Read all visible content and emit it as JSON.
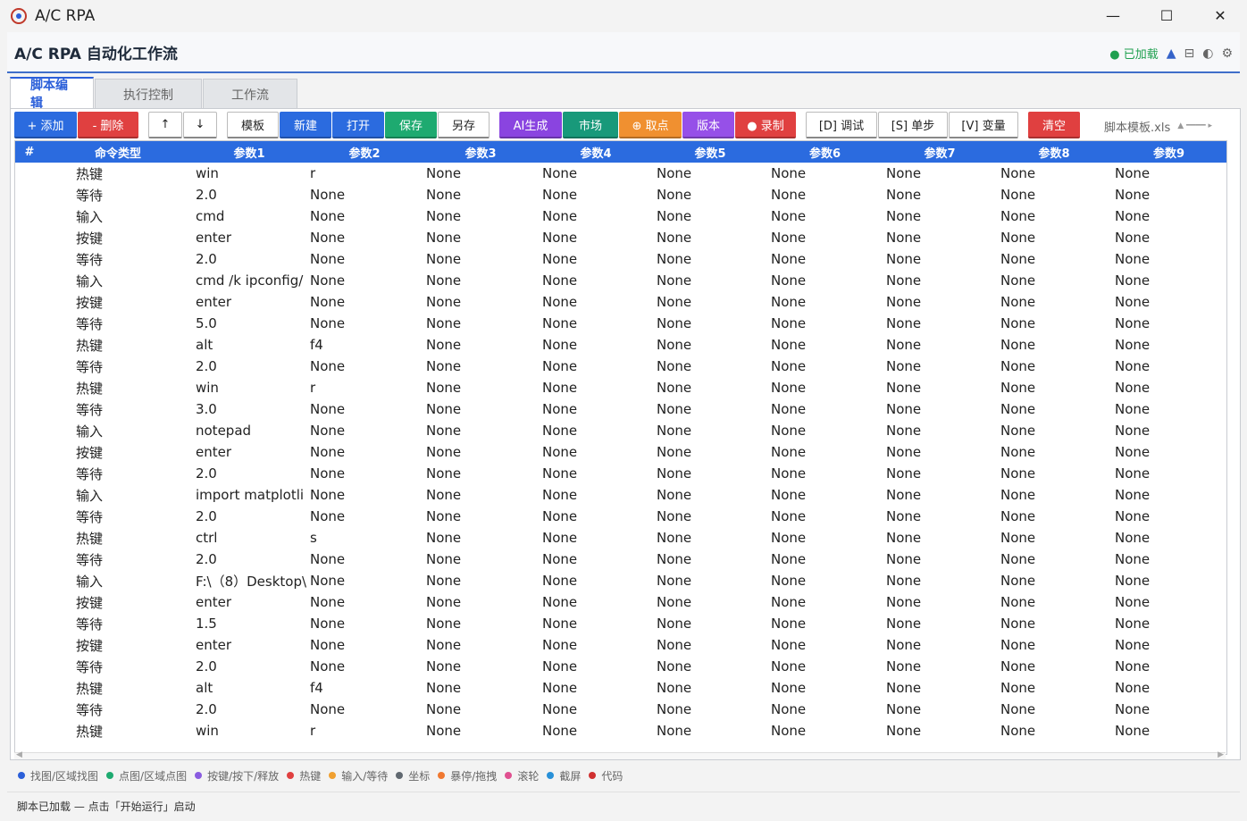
{
  "window": {
    "title": "A/C RPA",
    "controls": [
      "—",
      "☐",
      "✕"
    ]
  },
  "header": {
    "title": "A/C RPA 自动化工作流",
    "status": "● 已加载",
    "icons": [
      "▲",
      "⊟",
      "◐",
      "⚙"
    ]
  },
  "tabs": [
    {
      "label": "脚本编辑",
      "active": true
    },
    {
      "label": "执行控制",
      "active": false
    },
    {
      "label": "工作流",
      "active": false
    }
  ],
  "toolbar": {
    "buttons": [
      {
        "id": "add",
        "label": "+ 添加",
        "color": "#2b6bdf",
        "width": 70
      },
      {
        "id": "delete",
        "label": "- 删除",
        "color": "#e04040",
        "width": 68
      },
      {
        "id": "gap1",
        "gap": true
      },
      {
        "id": "up",
        "label": "↑",
        "color": "white",
        "width": 38
      },
      {
        "id": "down",
        "label": "↓",
        "color": "white",
        "width": 38
      },
      {
        "id": "gap2",
        "gap": true
      },
      {
        "id": "template",
        "label": "模板",
        "color": "white",
        "width": 58
      },
      {
        "id": "new",
        "label": "新建",
        "color": "#2b6bdf",
        "width": 58
      },
      {
        "id": "open",
        "label": "打开",
        "color": "#2b6bdf",
        "width": 58
      },
      {
        "id": "save",
        "label": "保存",
        "color": "#1eaa70",
        "width": 58
      },
      {
        "id": "saveas",
        "label": "另存",
        "color": "white",
        "width": 58
      },
      {
        "id": "gap3",
        "gap": true
      },
      {
        "id": "ai",
        "label": "AI生成",
        "color": "#8a44e0",
        "width": 70
      },
      {
        "id": "market",
        "label": "市场",
        "color": "#18997a",
        "width": 62
      },
      {
        "id": "pick",
        "label": "⊕ 取点",
        "color": "#f09030",
        "width": 70
      },
      {
        "id": "version",
        "label": "版本",
        "color": "#9650e8",
        "width": 58
      },
      {
        "id": "record",
        "label": "● 录制",
        "color": "#e04040",
        "width": 68
      },
      {
        "id": "gap4",
        "gap": true
      },
      {
        "id": "debug",
        "label": "[D] 调试",
        "color": "white",
        "width": 80
      },
      {
        "id": "step",
        "label": "[S] 单步",
        "color": "white",
        "width": 78
      },
      {
        "id": "vars",
        "label": "[V] 变量",
        "color": "white",
        "width": 78
      },
      {
        "id": "gap5",
        "gap": true
      },
      {
        "id": "clear",
        "label": "清空",
        "color": "#e04040",
        "width": 58
      }
    ],
    "template_file": "脚本模板.xls"
  },
  "table": {
    "headers": [
      "#",
      "命令类型",
      "参数1",
      "参数2",
      "参数3",
      "参数4",
      "参数5",
      "参数6",
      "参数7",
      "参数8",
      "参数9"
    ],
    "rows": [
      [
        "热键",
        "win",
        "r",
        "None",
        "None",
        "None",
        "None",
        "None",
        "None",
        "None"
      ],
      [
        "等待",
        "2.0",
        "None",
        "None",
        "None",
        "None",
        "None",
        "None",
        "None",
        "None"
      ],
      [
        "输入",
        "cmd",
        "None",
        "None",
        "None",
        "None",
        "None",
        "None",
        "None",
        "None"
      ],
      [
        "按键",
        "enter",
        "None",
        "None",
        "None",
        "None",
        "None",
        "None",
        "None",
        "None"
      ],
      [
        "等待",
        "2.0",
        "None",
        "None",
        "None",
        "None",
        "None",
        "None",
        "None",
        "None"
      ],
      [
        "输入",
        "cmd /k ipconfig/",
        "None",
        "None",
        "None",
        "None",
        "None",
        "None",
        "None",
        "None"
      ],
      [
        "按键",
        "enter",
        "None",
        "None",
        "None",
        "None",
        "None",
        "None",
        "None",
        "None"
      ],
      [
        "等待",
        "5.0",
        "None",
        "None",
        "None",
        "None",
        "None",
        "None",
        "None",
        "None"
      ],
      [
        "热键",
        "alt",
        "f4",
        "None",
        "None",
        "None",
        "None",
        "None",
        "None",
        "None"
      ],
      [
        "等待",
        "2.0",
        "None",
        "None",
        "None",
        "None",
        "None",
        "None",
        "None",
        "None"
      ],
      [
        "热键",
        "win",
        "r",
        "None",
        "None",
        "None",
        "None",
        "None",
        "None",
        "None"
      ],
      [
        "等待",
        "3.0",
        "None",
        "None",
        "None",
        "None",
        "None",
        "None",
        "None",
        "None"
      ],
      [
        "输入",
        "notepad",
        "None",
        "None",
        "None",
        "None",
        "None",
        "None",
        "None",
        "None"
      ],
      [
        "按键",
        "enter",
        "None",
        "None",
        "None",
        "None",
        "None",
        "None",
        "None",
        "None"
      ],
      [
        "等待",
        "2.0",
        "None",
        "None",
        "None",
        "None",
        "None",
        "None",
        "None",
        "None"
      ],
      [
        "输入",
        "import matplotli",
        "None",
        "None",
        "None",
        "None",
        "None",
        "None",
        "None",
        "None"
      ],
      [
        "等待",
        "2.0",
        "None",
        "None",
        "None",
        "None",
        "None",
        "None",
        "None",
        "None"
      ],
      [
        "热键",
        "ctrl",
        "s",
        "None",
        "None",
        "None",
        "None",
        "None",
        "None",
        "None"
      ],
      [
        "等待",
        "2.0",
        "None",
        "None",
        "None",
        "None",
        "None",
        "None",
        "None",
        "None"
      ],
      [
        "输入",
        "F:\\（8）Desktop\\",
        "None",
        "None",
        "None",
        "None",
        "None",
        "None",
        "None",
        "None"
      ],
      [
        "按键",
        "enter",
        "None",
        "None",
        "None",
        "None",
        "None",
        "None",
        "None",
        "None"
      ],
      [
        "等待",
        "1.5",
        "None",
        "None",
        "None",
        "None",
        "None",
        "None",
        "None",
        "None"
      ],
      [
        "按键",
        "enter",
        "None",
        "None",
        "None",
        "None",
        "None",
        "None",
        "None",
        "None"
      ],
      [
        "等待",
        "2.0",
        "None",
        "None",
        "None",
        "None",
        "None",
        "None",
        "None",
        "None"
      ],
      [
        "热键",
        "alt",
        "f4",
        "None",
        "None",
        "None",
        "None",
        "None",
        "None",
        "None"
      ],
      [
        "等待",
        "2.0",
        "None",
        "None",
        "None",
        "None",
        "None",
        "None",
        "None",
        "None"
      ],
      [
        "热键",
        "win",
        "r",
        "None",
        "None",
        "None",
        "None",
        "None",
        "None",
        "None"
      ]
    ]
  },
  "legend": [
    {
      "label": "找图/区域找图",
      "color": "#2b5fd9"
    },
    {
      "label": "点图/区域点图",
      "color": "#1eaa70"
    },
    {
      "label": "按键/按下/释放",
      "color": "#8a5ce0"
    },
    {
      "label": "热键",
      "color": "#e04040"
    },
    {
      "label": "输入/等待",
      "color": "#f0a030"
    },
    {
      "label": "坐标",
      "color": "#606870"
    },
    {
      "label": "暴停/拖拽",
      "color": "#f07830"
    },
    {
      "label": "滚轮",
      "color": "#e05090"
    },
    {
      "label": "截屏",
      "color": "#2890d8"
    },
    {
      "label": "代码",
      "color": "#d03030"
    }
  ],
  "statusbar": {
    "text": "脚本已加载 — 点击「开始运行」启动"
  }
}
